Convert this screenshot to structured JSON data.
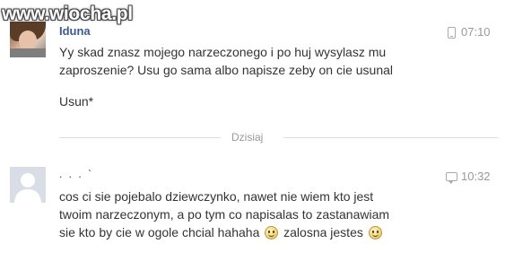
{
  "watermark": {
    "text": "www.wiocha.pl"
  },
  "thread": {
    "divider_label": "Dzisiaj",
    "messages": [
      {
        "sender": "Iduna",
        "time": "07:10",
        "source_icon": "phone-icon",
        "lines": [
          "Yy skad znasz mojego narzeczonego i po huj wysylasz mu",
          "zaproszenie? Usu go sama albo napisze zeby on cie usunal"
        ],
        "followup": "Usun*"
      },
      {
        "sender_redacted": ". .   .   `",
        "time": "10:32",
        "source_icon": "chat-icon",
        "line1": "cos ci sie pojebalo dziewczynko, nawet nie wiem kto jest",
        "line2": "twoim narzeczonym, a po tym co napisalas to zastanawiam",
        "line3a": "sie kto by cie w ogole chcial hahaha",
        "line3b": "zalosna jestes"
      }
    ]
  }
}
